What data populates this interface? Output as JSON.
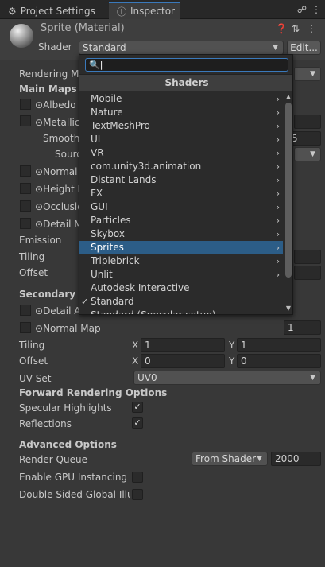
{
  "tabs": [
    {
      "label": "Project Settings",
      "icon": "gear-icon"
    },
    {
      "label": "Inspector",
      "icon": "info-icon"
    }
  ],
  "header": {
    "title": "Sprite (Material)",
    "shader_label": "Shader",
    "shader_value": "Standard",
    "edit_button": "Edit..."
  },
  "inspector": {
    "rendering_mode": "Rendering Mo",
    "main_maps": "Main Maps",
    "albedo": "Albedo",
    "metallic": "Metallic",
    "smoothness": "Smoothn",
    "smoothness_value": "5",
    "source": "Sourc",
    "normal_map": "Normal M",
    "height_map": "Height M",
    "occlusion": "Occlusio",
    "detail_mask": "Detail M",
    "emission": "Emission",
    "tiling": "Tiling",
    "offset": "Offset",
    "secondary_maps": "Secondary M",
    "detail_albedo": "Detail A",
    "secondary_normal_map": "Normal Map",
    "secondary_normal_value": "1",
    "tiling2": "Tiling",
    "tiling2_x_label": "X",
    "tiling2_x": "1",
    "tiling2_y_label": "Y",
    "tiling2_y": "1",
    "offset2": "Offset",
    "offset2_x_label": "X",
    "offset2_x": "0",
    "offset2_y_label": "Y",
    "offset2_y": "0",
    "uv_set": "UV Set",
    "uv_set_value": "UV0",
    "forward_options": "Forward Rendering Options",
    "specular_highlights": "Specular Highlights",
    "reflections": "Reflections",
    "advanced_options": "Advanced Options",
    "render_queue": "Render Queue",
    "render_queue_mode": "From Shader",
    "render_queue_value": "2000",
    "gpu_instancing": "Enable GPU Instancing",
    "double_sided": "Double Sided Global Illum"
  },
  "popup": {
    "search_value": "",
    "title": "Shaders",
    "items": [
      {
        "label": "Mobile",
        "submenu": true
      },
      {
        "label": "Nature",
        "submenu": true
      },
      {
        "label": "TextMeshPro",
        "submenu": true
      },
      {
        "label": "UI",
        "submenu": true
      },
      {
        "label": "VR",
        "submenu": true
      },
      {
        "label": "com.unity3d.animation",
        "submenu": true
      },
      {
        "label": "Distant Lands",
        "submenu": true
      },
      {
        "label": "FX",
        "submenu": true
      },
      {
        "label": "GUI",
        "submenu": true
      },
      {
        "label": "Particles",
        "submenu": true
      },
      {
        "label": "Skybox",
        "submenu": true
      },
      {
        "label": "Sprites",
        "submenu": true,
        "highlighted": true
      },
      {
        "label": "Triplebrick",
        "submenu": true
      },
      {
        "label": "Unlit",
        "submenu": true
      },
      {
        "label": "Autodesk Interactive",
        "submenu": false
      },
      {
        "label": "Standard",
        "submenu": false,
        "checked": true
      },
      {
        "label": "Standard (Specular setup)",
        "submenu": false
      }
    ]
  },
  "colors": {
    "highlight": "#2c5d87",
    "accent": "#3a79bb",
    "background": "#383838"
  }
}
